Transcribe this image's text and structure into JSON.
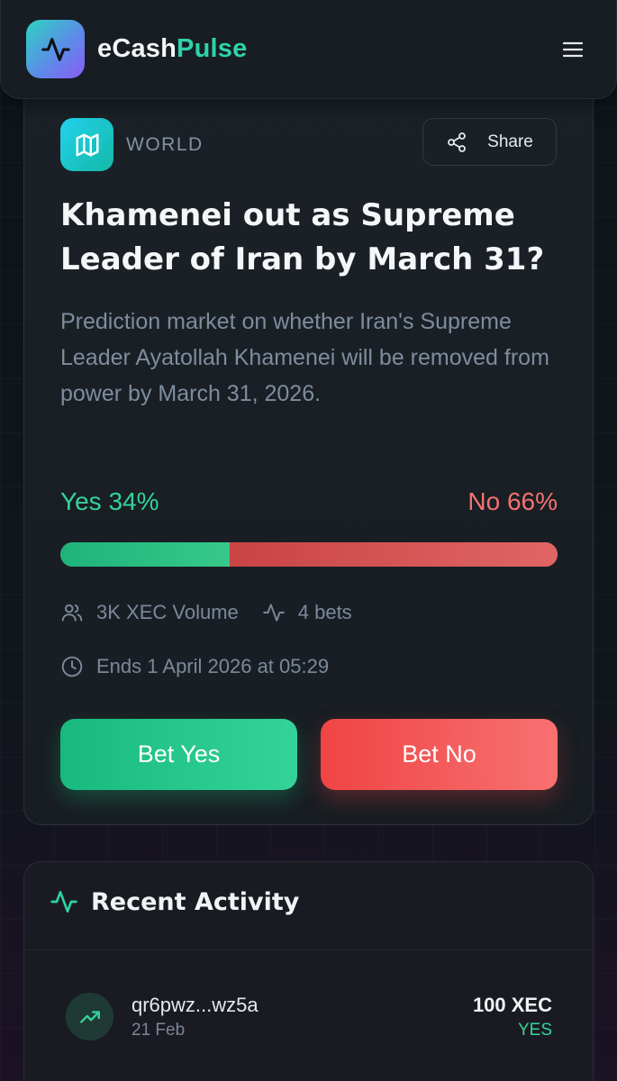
{
  "app": {
    "brand_prefix": "eCash",
    "brand_suffix": "Pulse"
  },
  "market": {
    "category": "WORLD",
    "share_label": "Share",
    "title": "Khamenei out as Supreme Leader of Iran by March 31?",
    "description": "Prediction market on whether Iran's Supreme Leader Ayatollah Khamenei will be removed from power by March 31, 2026.",
    "yes_label": "Yes 34%",
    "no_label": "No 66%",
    "yes_fraction": 0.34,
    "volume": "3K XEC Volume",
    "bets": "4 bets",
    "ends": "Ends 1 April 2026 at 05:29",
    "bet_yes_label": "Bet Yes",
    "bet_no_label": "Bet No"
  },
  "activity": {
    "title": "Recent Activity",
    "items": [
      {
        "address": "qr6pwz...wz5a",
        "date": "21 Feb",
        "amount": "100 XEC",
        "side": "YES"
      }
    ]
  },
  "colors": {
    "accent": "#2ed3a7",
    "yes": "#34d399",
    "no": "#f47272"
  },
  "icons": {
    "logo": "pulse-icon",
    "menu": "hamburger-menu-icon",
    "category": "map-icon",
    "share": "share-icon",
    "volume": "users-icon",
    "bets": "activity-icon",
    "ends": "clock-icon",
    "activity_header": "activity-icon",
    "activity_item": "trending-up-icon"
  }
}
